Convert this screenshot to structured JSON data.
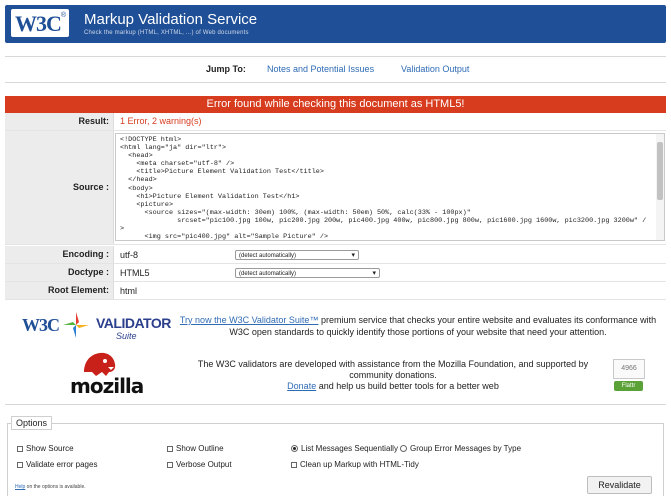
{
  "header": {
    "logo_text": "W3C",
    "logo_mark": "®",
    "title": "Markup Validation Service",
    "subtitle": "Check the markup (HTML, XHTML, ...) of Web documents"
  },
  "jump": {
    "label": "Jump To:",
    "links": [
      "Notes and Potential Issues",
      "Validation Output"
    ]
  },
  "error_banner": "Error found while checking this document as HTML5!",
  "result": {
    "label": "Result:",
    "value": "1 Error, 2 warning(s)"
  },
  "source": {
    "label": "Source :",
    "code": "<!DOCTYPE html>\n<html lang=\"ja\" dir=\"ltr\">\n  <head>\n    <meta charset=\"utf-8\" />\n    <title>Picture Element Validation Test</title>\n  </head>\n  <body>\n    <h1>Picture Element Validation Test</h1>\n    <picture>\n      <source sizes=\"(max-width: 30em) 100%, (max-width: 50em) 50%, calc(33% - 100px)\"\n              srcset=\"pic100.jpg 100w, pic200.jpg 200w, pic400.jpg 400w, pic800.jpg 800w, pic1600.jpg 1600w, pic3200.jpg 3200w\" />\n      <img src=\"pic400.jpg\" alt=\"Sample Picture\" />"
  },
  "encoding": {
    "label": "Encoding :",
    "value": "utf-8",
    "select": "(detect automatically)"
  },
  "doctype": {
    "label": "Doctype :",
    "value": "HTML5",
    "select": "(detect automatically)"
  },
  "root_element": {
    "label": "Root Element:",
    "value": "html"
  },
  "validator_suite": {
    "logo_w3c": "W3C",
    "logo_validator": "VALIDATOR",
    "logo_suite": "Suite",
    "link": "Try now the W3C Validator Suite™",
    "text": " premium service that checks your entire website and evaluates its conformance with W3C open standards to quickly identify those portions of your website that need your attention."
  },
  "mozilla": {
    "logo_text": "mozilla",
    "text": "The W3C validators are developed with assistance from the Mozilla Foundation, and supported by community donations.",
    "donate_link": "Donate",
    "donate_text": " and help us build better tools for a better web",
    "counter": "4966",
    "flattr": "Flattr"
  },
  "options": {
    "legend": "Options",
    "show_source": "Show Source",
    "show_outline": "Show Outline",
    "list_sequential": "List Messages Sequentially",
    "group_by_type": "Group Error Messages by Type",
    "validate_error_pages": "Validate error pages",
    "verbose_output": "Verbose Output",
    "clean_up": "Clean up Markup with HTML-Tidy",
    "help_link": "Help",
    "help_text": " on the options is available.",
    "revalidate": "Revalidate"
  },
  "colors": {
    "banner": "#1f4f96",
    "error": "#d73c1e",
    "link": "#2e6bb5"
  }
}
